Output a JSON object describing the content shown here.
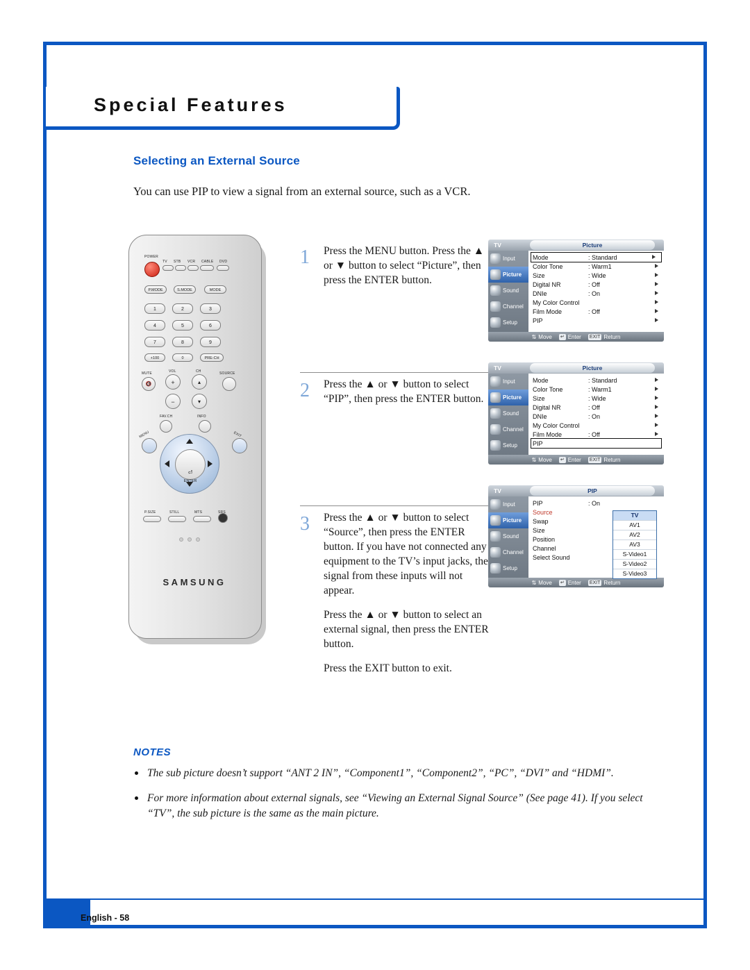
{
  "page": {
    "header_title": "Special Features",
    "section_title": "Selecting an External Source",
    "intro": "You can use PIP to view a signal from an external source, such as a VCR.",
    "footer": "English - 58"
  },
  "steps": [
    {
      "num": "1",
      "text": "Press the MENU button. Press the ▲ or ▼ button to select “Picture”, then press the ENTER button."
    },
    {
      "num": "2",
      "text": "Press the ▲ or ▼ button to select “PIP”, then press the ENTER button."
    },
    {
      "num": "3",
      "text": "Press the ▲ or ▼ button to select “Source”, then press the ENTER button. If you have not connected any equipment to the TV’s input jacks, the signal from these inputs will not appear.",
      "extra1": "Press the ▲ or ▼ button to select an external signal, then press the ENTER button.",
      "extra2": "Press the EXIT button to exit."
    }
  ],
  "osd_common": {
    "tv_label": "TV",
    "sidebar": [
      "Input",
      "Picture",
      "Sound",
      "Channel",
      "Setup"
    ],
    "footer": {
      "move": "Move",
      "enter": "Enter",
      "return": "Return",
      "enter_key": "↵",
      "return_key": "EXIT"
    }
  },
  "osd1": {
    "title": "Picture",
    "rows": [
      {
        "name": "Mode",
        "value": ": Standard",
        "arrow": true,
        "selected": true
      },
      {
        "name": "Color Tone",
        "value": ": Warm1",
        "arrow": true
      },
      {
        "name": "Size",
        "value": ": Wide",
        "arrow": true
      },
      {
        "name": "Digital NR",
        "value": ": Off",
        "arrow": true
      },
      {
        "name": "DNIe",
        "value": ": On",
        "arrow": true
      },
      {
        "name": "My Color Control",
        "value": "",
        "arrow": true
      },
      {
        "name": "Film Mode",
        "value": ": Off",
        "arrow": true
      },
      {
        "name": "PIP",
        "value": "",
        "arrow": true
      }
    ]
  },
  "osd2": {
    "title": "Picture",
    "rows": [
      {
        "name": "Mode",
        "value": ": Standard",
        "arrow": true
      },
      {
        "name": "Color Tone",
        "value": ": Warm1",
        "arrow": true
      },
      {
        "name": "Size",
        "value": ": Wide",
        "arrow": true
      },
      {
        "name": "Digital NR",
        "value": ": Off",
        "arrow": true
      },
      {
        "name": "DNIe",
        "value": ": On",
        "arrow": true
      },
      {
        "name": "My Color Control",
        "value": "",
        "arrow": true
      },
      {
        "name": "Film Mode",
        "value": ": Off",
        "arrow": true
      },
      {
        "name": "PIP",
        "value": "",
        "arrow": false,
        "selected": true
      }
    ]
  },
  "osd3": {
    "title": "PIP",
    "rows": [
      {
        "name": "PIP",
        "value": ": On"
      },
      {
        "name": "Source",
        "value": "",
        "highlight": true
      },
      {
        "name": "Swap",
        "value": ""
      },
      {
        "name": "Size",
        "value": ""
      },
      {
        "name": "Position",
        "value": ""
      },
      {
        "name": "Channel",
        "value": ""
      },
      {
        "name": "Select Sound",
        "value": ""
      }
    ],
    "source_list": [
      "TV",
      "AV1",
      "AV2",
      "AV3",
      "S-Video1",
      "S-Video2",
      "S-Video3"
    ],
    "source_selected": "TV"
  },
  "notes": {
    "title": "NOTES",
    "items": [
      "The sub picture doesn’t support “ANT 2 IN”, “Component1”, “Component2”, “PC”, “DVI” and “HDMI”.",
      "For more information about external signals, see “Viewing an External Signal Source” (See page 41).  If you select “TV”, the sub picture is the same as the main picture."
    ]
  },
  "remote": {
    "brand": "SAMSUNG",
    "power_label": "POWER",
    "device_buttons": [
      "TV",
      "STB",
      "VCR",
      "CABLE",
      "DVD"
    ],
    "mode_row": [
      "P.MODE",
      "S.MODE",
      "MODE"
    ],
    "keypad": [
      "1",
      "2",
      "3",
      "4",
      "5",
      "6",
      "7",
      "8",
      "9",
      "+100",
      "0",
      "PRE-CH"
    ],
    "vol_label": "VOL",
    "ch_label": "CH",
    "mute_label": "MUTE",
    "source_label": "SOURCE",
    "fav_label": "FAV.CH",
    "info_label": "INFO",
    "menu_label": "MENU",
    "exit_label": "EXIT",
    "enter_label": "ENTER",
    "bottom_row": [
      "P.SIZE",
      "STILL",
      "MTS",
      "SRS"
    ]
  }
}
